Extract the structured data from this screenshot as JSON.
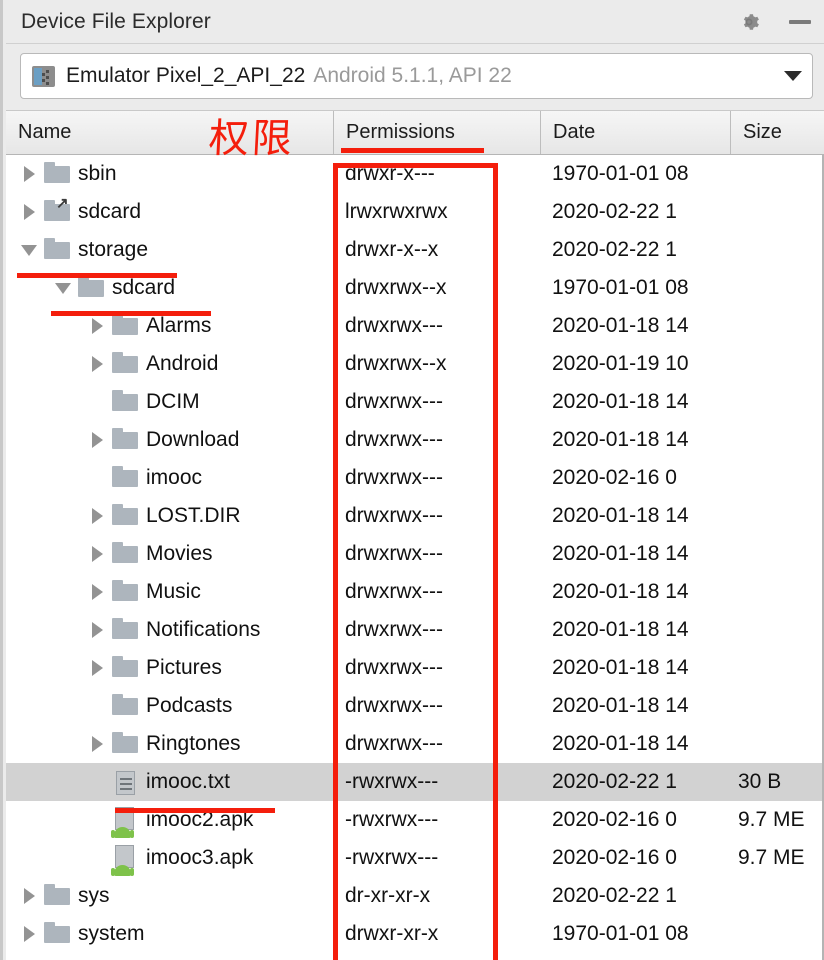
{
  "window": {
    "title": "Device File Explorer",
    "settings_icon": "gear-icon",
    "minimize_icon": "minimize-icon"
  },
  "device_selector": {
    "icon": "device-icon",
    "name": "Emulator Pixel_2_API_22",
    "meta": "Android 5.1.1, API 22",
    "dropdown_icon": "chevron-down-icon"
  },
  "columns": [
    {
      "key": "name",
      "label": "Name"
    },
    {
      "key": "permissions",
      "label": "Permissions"
    },
    {
      "key": "date",
      "label": "Date"
    },
    {
      "key": "size",
      "label": "Size"
    }
  ],
  "annotations": {
    "cjk_note": "权限",
    "box_color": "#f41e0c",
    "underlined_items": [
      "Permissions",
      "storage",
      "sdcard",
      "imooc.txt"
    ]
  },
  "colors": {
    "annotation_red": "#f41e0c",
    "selection_gray": "#d2d2d2",
    "folder_gray": "#adb5bd",
    "android_green": "#7ec24a",
    "chrome_gray": "#ebebeb"
  },
  "rows": [
    {
      "name": "sbin",
      "depth": 0,
      "icon": "folder-icon",
      "expander": "collapsed",
      "permissions": "drwxr-x---",
      "date": "1970-01-01 08",
      "size": "",
      "selected": false
    },
    {
      "name": "sdcard",
      "depth": 0,
      "icon": "symlink-folder-icon",
      "expander": "collapsed",
      "permissions": "lrwxrwxrwx",
      "date": "2020-02-22 1",
      "size": "",
      "selected": false
    },
    {
      "name": "storage",
      "depth": 0,
      "icon": "folder-icon",
      "expander": "expanded",
      "permissions": "drwxr-x--x",
      "date": "2020-02-22 1",
      "size": "",
      "selected": false
    },
    {
      "name": "sdcard",
      "depth": 1,
      "icon": "folder-icon",
      "expander": "expanded",
      "permissions": "drwxrwx--x",
      "date": "1970-01-01 08",
      "size": "",
      "selected": false
    },
    {
      "name": "Alarms",
      "depth": 2,
      "icon": "folder-icon",
      "expander": "collapsed",
      "permissions": "drwxrwx---",
      "date": "2020-01-18 14",
      "size": "",
      "selected": false
    },
    {
      "name": "Android",
      "depth": 2,
      "icon": "folder-icon",
      "expander": "collapsed",
      "permissions": "drwxrwx--x",
      "date": "2020-01-19 10",
      "size": "",
      "selected": false
    },
    {
      "name": "DCIM",
      "depth": 2,
      "icon": "folder-icon",
      "expander": "none",
      "permissions": "drwxrwx---",
      "date": "2020-01-18 14",
      "size": "",
      "selected": false
    },
    {
      "name": "Download",
      "depth": 2,
      "icon": "folder-icon",
      "expander": "collapsed",
      "permissions": "drwxrwx---",
      "date": "2020-01-18 14",
      "size": "",
      "selected": false
    },
    {
      "name": "imooc",
      "depth": 2,
      "icon": "folder-icon",
      "expander": "none",
      "permissions": "drwxrwx---",
      "date": "2020-02-16 0",
      "size": "",
      "selected": false
    },
    {
      "name": "LOST.DIR",
      "depth": 2,
      "icon": "folder-icon",
      "expander": "collapsed",
      "permissions": "drwxrwx---",
      "date": "2020-01-18 14",
      "size": "",
      "selected": false
    },
    {
      "name": "Movies",
      "depth": 2,
      "icon": "folder-icon",
      "expander": "collapsed",
      "permissions": "drwxrwx---",
      "date": "2020-01-18 14",
      "size": "",
      "selected": false
    },
    {
      "name": "Music",
      "depth": 2,
      "icon": "folder-icon",
      "expander": "collapsed",
      "permissions": "drwxrwx---",
      "date": "2020-01-18 14",
      "size": "",
      "selected": false
    },
    {
      "name": "Notifications",
      "depth": 2,
      "icon": "folder-icon",
      "expander": "collapsed",
      "permissions": "drwxrwx---",
      "date": "2020-01-18 14",
      "size": "",
      "selected": false
    },
    {
      "name": "Pictures",
      "depth": 2,
      "icon": "folder-icon",
      "expander": "collapsed",
      "permissions": "drwxrwx---",
      "date": "2020-01-18 14",
      "size": "",
      "selected": false
    },
    {
      "name": "Podcasts",
      "depth": 2,
      "icon": "folder-icon",
      "expander": "none",
      "permissions": "drwxrwx---",
      "date": "2020-01-18 14",
      "size": "",
      "selected": false
    },
    {
      "name": "Ringtones",
      "depth": 2,
      "icon": "folder-icon",
      "expander": "collapsed",
      "permissions": "drwxrwx---",
      "date": "2020-01-18 14",
      "size": "",
      "selected": false
    },
    {
      "name": "imooc.txt",
      "depth": 2,
      "icon": "text-file-icon",
      "expander": "none",
      "permissions": "-rwxrwx---",
      "date": "2020-02-22 1",
      "size": "30 B",
      "selected": true
    },
    {
      "name": "imooc2.apk",
      "depth": 2,
      "icon": "apk-file-icon",
      "expander": "none",
      "permissions": "-rwxrwx---",
      "date": "2020-02-16 0",
      "size": "9.7 ME",
      "selected": false
    },
    {
      "name": "imooc3.apk",
      "depth": 2,
      "icon": "apk-file-icon",
      "expander": "none",
      "permissions": "-rwxrwx---",
      "date": "2020-02-16 0",
      "size": "9.7 ME",
      "selected": false
    },
    {
      "name": "sys",
      "depth": 0,
      "icon": "folder-icon",
      "expander": "collapsed",
      "permissions": "dr-xr-xr-x",
      "date": "2020-02-22 1",
      "size": "",
      "selected": false
    },
    {
      "name": "system",
      "depth": 0,
      "icon": "folder-icon",
      "expander": "collapsed",
      "permissions": "drwxr-xr-x",
      "date": "1970-01-01 08",
      "size": "",
      "selected": false
    }
  ]
}
